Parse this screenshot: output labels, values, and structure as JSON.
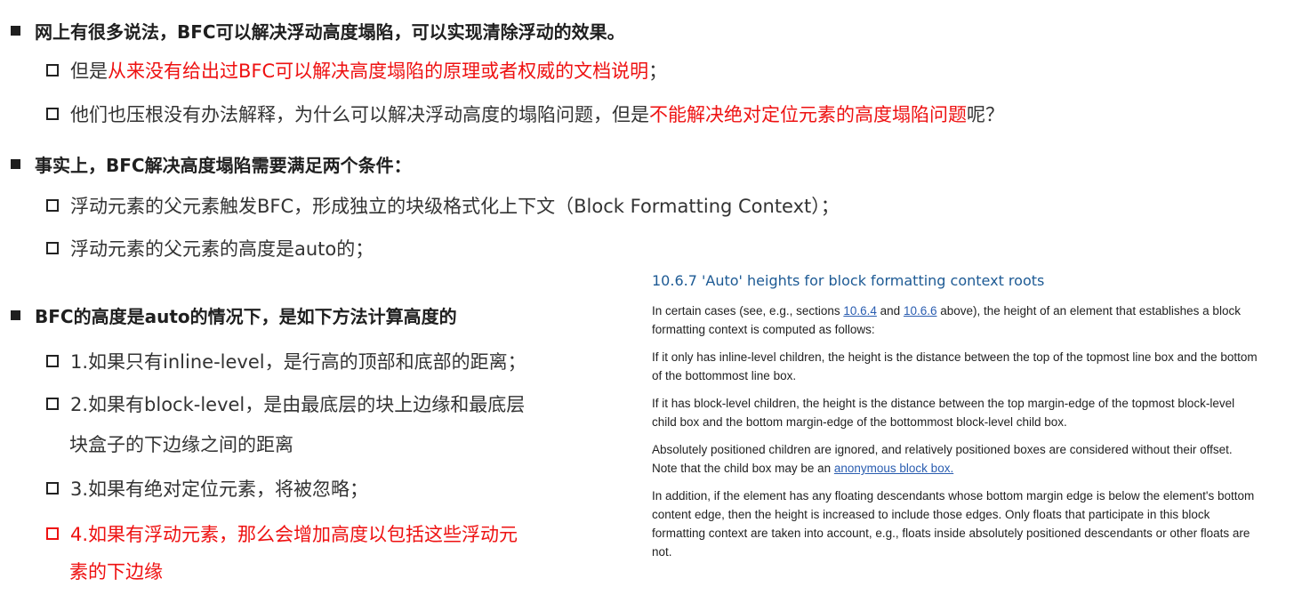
{
  "section1": {
    "heading": "网上有很多说法，BFC可以解决浮动高度塌陷，可以实现清除浮动的效果。",
    "item1": {
      "prefix": "但是",
      "red": "从来没有给出过BFC可以解决高度塌陷的原理或者权威的文档说明",
      "suffix": "；"
    },
    "item2": {
      "prefix": "他们也压根没有办法解释，为什么可以解决浮动高度的塌陷问题，但是",
      "red": "不能解决绝对定位元素的高度塌陷问题",
      "suffix": "呢？"
    }
  },
  "section2": {
    "heading": "事实上，BFC解决高度塌陷需要满足两个条件：",
    "item1": "浮动元素的父元素触发BFC，形成独立的块级格式化上下文（Block Formatting Context）；",
    "item2": "浮动元素的父元素的高度是auto的；"
  },
  "section3": {
    "heading": "BFC的高度是auto的情况下，是如下方法计算高度的",
    "item1": "1.如果只有inline-level，是行高的顶部和底部的距离；",
    "item2_line1": "2.如果有block-level，是由最底层的块上边缘和最底层",
    "item2_line2": "块盒子的下边缘之间的距离",
    "item3": "3.如果有绝对定位元素，将被忽略；",
    "item4_line1": "4.如果有浮动元素，那么会增加高度以包括这些浮动元",
    "item4_line2": "素的下边缘"
  },
  "spec": {
    "title": "10.6.7 'Auto' heights for block formatting context roots",
    "p1_a": "In certain cases (see, e.g., sections ",
    "p1_link1": "10.6.4",
    "p1_b": " and ",
    "p1_link2": "10.6.6",
    "p1_c": " above), the height of an element that establishes a block formatting context is computed as follows:",
    "p2": "If it only has inline-level children, the height is the distance between the top of the topmost line box and the bottom of the bottommost line box.",
    "p3": "If it has block-level children, the height is the distance between the top margin-edge of the topmost block-level child box and the bottom margin-edge of the bottommost block-level child box.",
    "p4_a": "Absolutely positioned children are ignored, and relatively positioned boxes are considered without their offset. Note that the child box may be an ",
    "p4_link": "anonymous block box.",
    "p5": "In addition, if the element has any floating descendants whose bottom margin edge is below the element's bottom content edge, then the height is increased to include those edges. Only floats that participate in this block formatting context are taken into account, e.g., floats inside absolutely positioned descendants or other floats are not."
  }
}
